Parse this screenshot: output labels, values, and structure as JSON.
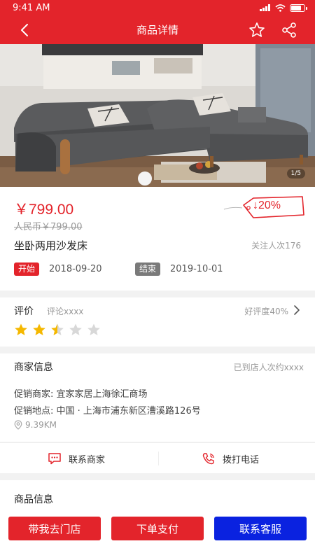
{
  "status_bar": {
    "time": "9:41 AM"
  },
  "nav": {
    "title": "商品详情"
  },
  "gallery": {
    "indicator": "1/5"
  },
  "product": {
    "price": "￥799.00",
    "old_price": "人民币￥799.00",
    "discount": "↓20%",
    "name": "坐卧两用沙发床",
    "follow": "关注人次176",
    "start_label": "开始",
    "start_date": "2018-09-20",
    "end_label": "结束",
    "end_date": "2019-10-01"
  },
  "rating": {
    "title": "评价",
    "comment": "评论xxxx",
    "good_rate": "好评度40%",
    "stars": 2.5,
    "max_stars": 5
  },
  "merchant": {
    "title": "商家信息",
    "visits": "已到店人次约xxxx",
    "promoter": "促销商家:  宜家家居上海徐汇商场",
    "location": "促销地点:  中国 · 上海市浦东新区漕溪路126号",
    "distance": "9.39KM"
  },
  "contact": {
    "merchant": "联系商家",
    "call": "拨打电话"
  },
  "info": {
    "title": "商品信息"
  },
  "actions": {
    "store": "带我去门店",
    "pay": "下单支付",
    "service": "联系客服"
  },
  "colors": {
    "primary": "#e3242b",
    "service": "#0a22e0",
    "star": "#f5b800",
    "star_empty": "#d8d8d8"
  }
}
